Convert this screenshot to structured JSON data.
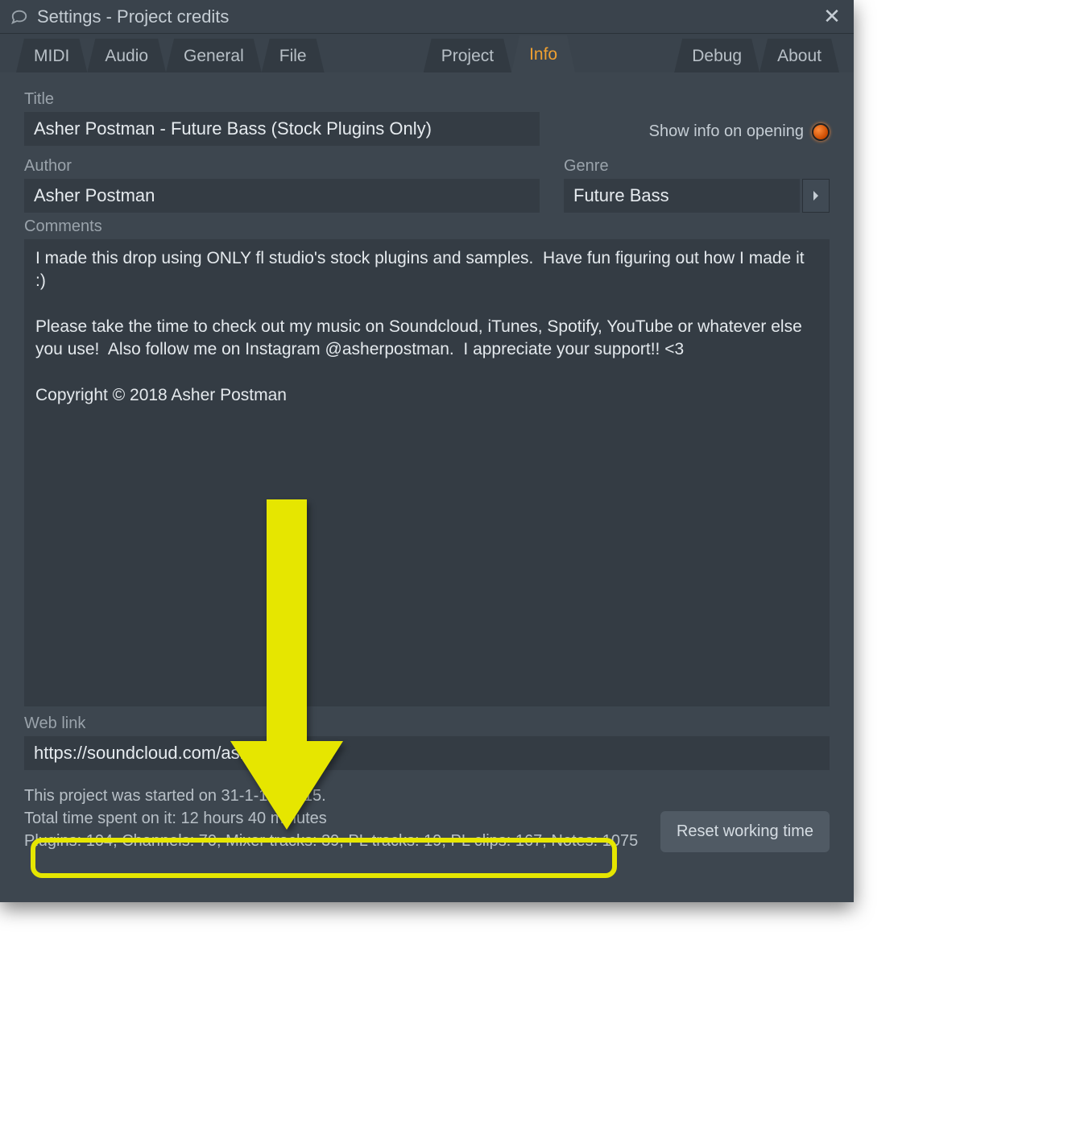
{
  "window": {
    "title": "Settings - Project credits"
  },
  "tabs": {
    "midi": "MIDI",
    "audio": "Audio",
    "general": "General",
    "file": "File",
    "project": "Project",
    "info": "Info",
    "debug": "Debug",
    "about": "About"
  },
  "fields": {
    "title_label": "Title",
    "title_value": "Asher Postman - Future Bass (Stock Plugins Only)",
    "showinfo_label": "Show info on opening",
    "author_label": "Author",
    "author_value": "Asher Postman",
    "genre_label": "Genre",
    "genre_value": "Future Bass",
    "comments_label": "Comments",
    "comments_value": "I made this drop using ONLY fl studio's stock plugins and samples.  Have fun figuring out how I made it :)\n\nPlease take the time to check out my music on Soundcloud, iTunes, Spotify, YouTube or whatever else you use!  Also follow me on Instagram @asherpostman.  I appreciate your support!! <3\n\nCopyright © 2018 Asher Postman",
    "weblink_label": "Web link",
    "weblink_value": "https://soundcloud.com/asherpostman"
  },
  "footer": {
    "started_line": "This project was started on 31-1-18 21:15.",
    "timespent_line": "Total time spent on it: 12 hours 40 minutes",
    "stats_line": "Plugins: 104, Channels: 70, Mixer tracks: 39, PL tracks: 19, PL clips: 167, Notes: 1075",
    "reset_label": "Reset working time"
  },
  "annotation": {
    "arrow_color": "#e6e600"
  }
}
